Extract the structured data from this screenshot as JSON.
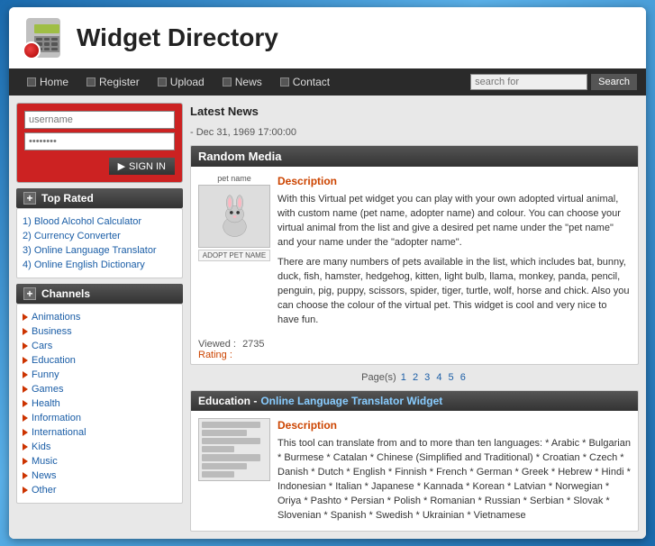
{
  "header": {
    "title": "Widget Directory",
    "logo_alt": "Widget Directory Logo"
  },
  "navbar": {
    "items": [
      {
        "label": "Home",
        "id": "home"
      },
      {
        "label": "Register",
        "id": "register"
      },
      {
        "label": "Upload",
        "id": "upload"
      },
      {
        "label": "News",
        "id": "news"
      },
      {
        "label": "Contact",
        "id": "contact"
      }
    ],
    "search_placeholder": "search for",
    "search_button": "Search"
  },
  "login": {
    "username_placeholder": "username",
    "password_placeholder": "••••••••",
    "signin_label": "SIGN IN"
  },
  "top_rated": {
    "title": "Top Rated",
    "items": [
      {
        "label": "1) Blood Alcohol Calculator"
      },
      {
        "label": "2) Currency Converter"
      },
      {
        "label": "3) Online Language Translator"
      },
      {
        "label": "4) Online English Dictionary"
      }
    ]
  },
  "channels": {
    "title": "Channels",
    "items": [
      {
        "label": "Animations"
      },
      {
        "label": "Business"
      },
      {
        "label": "Cars"
      },
      {
        "label": "Education"
      },
      {
        "label": "Funny"
      },
      {
        "label": "Games"
      },
      {
        "label": "Health"
      },
      {
        "label": "Information"
      },
      {
        "label": "International"
      },
      {
        "label": "Kids"
      },
      {
        "label": "Music"
      },
      {
        "label": "News"
      },
      {
        "label": "Other"
      }
    ]
  },
  "main": {
    "latest_news_title": "Latest News",
    "date_line": "- Dec 31, 1969 17:00:00",
    "widget1": {
      "header": "Random Media",
      "thumb_label": "pet name",
      "thumb_footer": "ADOPT PET NAME",
      "desc_title": "Description",
      "description": "With this Virtual pet widget you can play with your own adopted virtual animal, with custom name (pet name, adopter name) and colour. You can choose your virtual animal from the list and give a desired pet name under the \"pet name\" and your name under the \"adopter name\".",
      "description2": "There are many numbers of pets available in the list, which includes bat, bunny, duck, fish, hamster, hedgehog, kitten, light bulb, llama, monkey, panda, pencil, penguin, pig, puppy, scissors, spider, tiger, turtle, wolf, horse and chick. Also you can choose the colour of the virtual pet. This widget is cool and very nice to have fun.",
      "viewed_label": "Viewed :",
      "viewed_count": "2735",
      "rating_label": "Rating :"
    },
    "pagination": {
      "label": "Page(s)",
      "pages": [
        "1",
        "2",
        "3",
        "4",
        "5",
        "6"
      ]
    },
    "widget2": {
      "category": "Education -",
      "title": "Online Language Translator Widget",
      "desc_title": "Description",
      "description": "This tool can translate from and to more than ten languages: * Arabic * Bulgarian * Burmese * Catalan * Chinese (Simplified and Traditional) * Croatian * Czech * Danish * Dutch * English * Finnish * French * German * Greek * Hebrew * Hindi * Indonesian * Italian * Japanese * Kannada * Korean * Latvian * Norwegian * Oriya * Pashto * Persian * Polish * Romanian * Russian * Serbian * Slovak * Slovenian * Spanish * Swedish * Ukrainian * Vietnamese"
    }
  }
}
